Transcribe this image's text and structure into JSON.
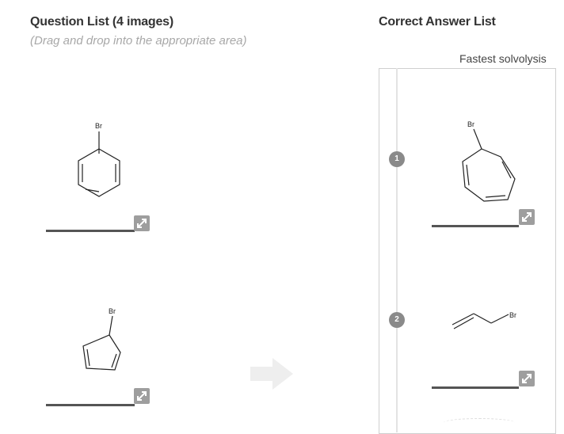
{
  "question_list": {
    "title": "Question List (4 images)",
    "subtitle": "(Drag and drop into the appropriate area)",
    "items": [
      {
        "molecule": "bromobenzene",
        "atom_label": "Br"
      },
      {
        "molecule": "bromocyclopentadiene",
        "atom_label": "Br"
      }
    ]
  },
  "answer_list": {
    "title": "Correct Answer List",
    "top_label": "Fastest solvolysis",
    "items": [
      {
        "rank": "1",
        "molecule": "bromocycloheptatriene",
        "atom_label": "Br"
      },
      {
        "rank": "2",
        "molecule": "allyl bromide",
        "atom_label": "Br"
      }
    ]
  },
  "icons": {
    "expand": "expand-icon",
    "move": "arrow-right-icon"
  },
  "colors": {
    "badge": "#8a8a8a",
    "expand_button": "#9e9e9e",
    "arrow": "#eeeeee",
    "subtitle": "#a8a8a8"
  }
}
